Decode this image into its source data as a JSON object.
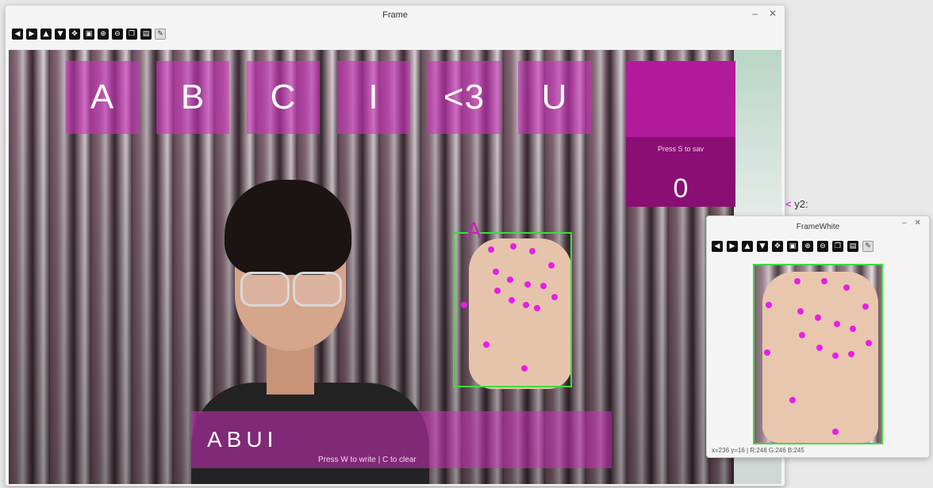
{
  "frame_window": {
    "title": "Frame",
    "toolbar_icons": [
      "arrow-left-icon",
      "arrow-right-icon",
      "arrow-up-icon",
      "arrow-down-icon",
      "pan-icon",
      "zoom-fit-icon",
      "zoom-in-icon",
      "zoom-out-icon",
      "copy-icon",
      "save-icon",
      "brush-icon"
    ],
    "keys": [
      "A",
      "B",
      "C",
      "I",
      "<3",
      "U"
    ],
    "counter": {
      "hint": "Press S to sav",
      "value": "0"
    },
    "prediction": "A",
    "typed": {
      "text": "ABUI",
      "hint": "Press W to write | C to clear"
    }
  },
  "coord_readout": {
    "arrow": "<",
    "text": "y2:"
  },
  "white_window": {
    "title": "FrameWhite",
    "toolbar_icons": [
      "arrow-left-icon",
      "arrow-right-icon",
      "arrow-up-icon",
      "arrow-down-icon",
      "pan-icon",
      "zoom-fit-icon",
      "zoom-in-icon",
      "zoom-out-icon",
      "copy-icon",
      "save-icon",
      "brush-icon"
    ],
    "status": "x=236 y=16 | R:248 G:246 B:245"
  },
  "colors": {
    "overlay_magenta": "#cd32be",
    "landmark": "#e61ee6",
    "bbox_green": "#3ddc3d"
  }
}
